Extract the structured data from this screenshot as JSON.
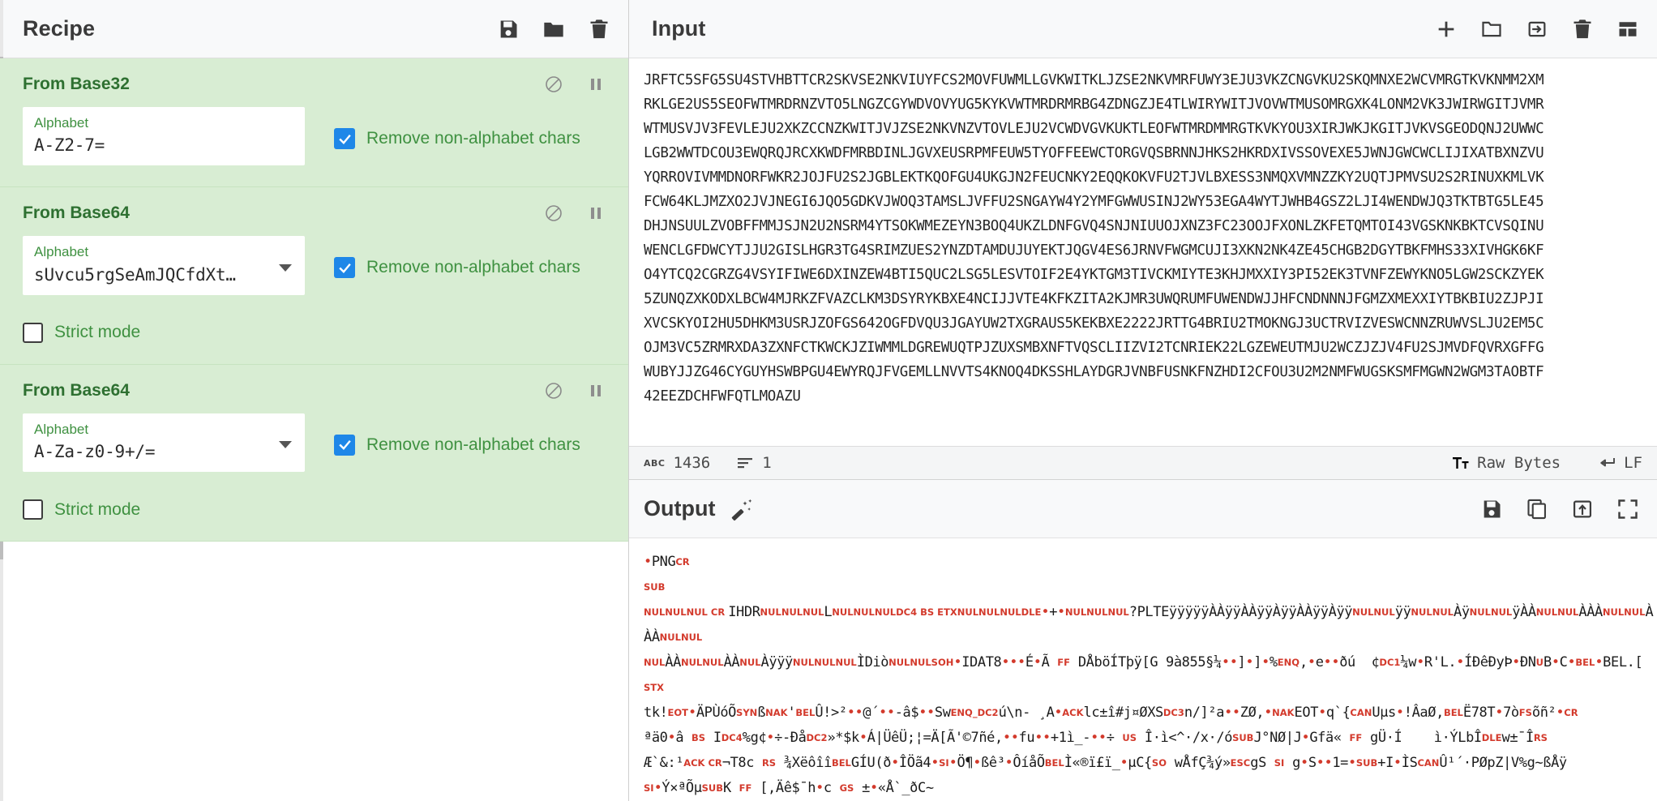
{
  "recipe": {
    "title": "Recipe",
    "header_icons": [
      {
        "name": "save-recipe-icon",
        "label": "Save recipe"
      },
      {
        "name": "load-recipe-icon",
        "label": "Load recipe"
      },
      {
        "name": "clear-recipe-icon",
        "label": "Clear recipe"
      }
    ],
    "operations": [
      {
        "title": "From Base32",
        "arg_label": "Alphabet",
        "arg_value": "A-Z2-7=",
        "has_dropdown": false,
        "checkbox_label": "Remove non-alphabet chars",
        "checkbox_checked": true,
        "has_strict": false,
        "strict_label": "",
        "strict_checked": false,
        "disable_icon": "disable-operation-icon",
        "pause_icon": "breakpoint-icon"
      },
      {
        "title": "From Base64",
        "arg_label": "Alphabet",
        "arg_value": "sUvcu5rgSeAmJQCfdXt…",
        "has_dropdown": true,
        "checkbox_label": "Remove non-alphabet chars",
        "checkbox_checked": true,
        "has_strict": true,
        "strict_label": "Strict mode",
        "strict_checked": false,
        "disable_icon": "disable-operation-icon",
        "pause_icon": "breakpoint-icon"
      },
      {
        "title": "From Base64",
        "arg_label": "Alphabet",
        "arg_value": "A-Za-z0-9+/=",
        "has_dropdown": true,
        "checkbox_label": "Remove non-alphabet chars",
        "checkbox_checked": true,
        "has_strict": true,
        "strict_label": "Strict mode",
        "strict_checked": false,
        "disable_icon": "disable-operation-icon",
        "pause_icon": "breakpoint-icon"
      }
    ]
  },
  "input": {
    "title": "Input",
    "header_icons": [
      {
        "name": "add-input-tab-icon",
        "label": "Add a new input tab"
      },
      {
        "name": "open-folder-icon",
        "label": "Open folder as input"
      },
      {
        "name": "open-file-icon",
        "label": "Open file as input"
      },
      {
        "name": "clear-input-icon",
        "label": "Clear input and output"
      },
      {
        "name": "reset-pane-layout-icon",
        "label": "Reset pane layout"
      }
    ],
    "text": "JRFTC5SFG5SU4STVHBTTCR2SKVSE2NKVIUYFCS2MOVFUWMLLGVKWITKLJZSE2NKVMRFUWY3EJU3VKZCNGVKU2SKQMNXE2WCVMRGTKVKNMM2XM\nRKLGE2US5SEOFWTMRDRNZVTO5LNGZCGYWDVOVYUG5KYKVWTMRDRMRBG4ZDNGZJE4TLWIRYWITJVOVWTMUSOMRGXK4LONM2VK3JWIRWGITJVMR\nWTMUSVJV3FEVLEJU2XKZCCNZKWITJVJZSE2NKVNZVTOVLEJU2VCWDVGVKUKTLEOFWTMRDMMRGTKVKYOU3XIRJWKJKGITJVKVSGEODQNJ2UWWC\nLGB2WWTDCOU3EWQRQJRCXKWDFMRBDINLJGVXEUSRPMFEUW5TYOFFEEWCTORGVQSBRNNJHKS2HKRDXIVSSOVEXE5JWNJGWCWCLIJIXATBXNZVU\nYQRROVIVMMDNORFWKR2JOJFU2S2JGBLEKTKQOFGU4UKGJN2FEUCNKY2EQQKOKVFU2TJVLBXESS3NMQXVMNZZKY2UQTJPMVSU2S2RINUXKMLVK\nFCW64KLJMZXO2JVJNEGI6JQO5GDKVJWOQ3TAMSLJVFFU2SNGAYW4Y2YMFGWWUSINJ2WY53EGA4WYTJWHB4GSZ2LJI4WENDWJQ3TKTBTG5LE45\nDHJNSUULZVOBFFMMJSJN2U2NSRM4YTSOKWMEZEYN3BOQ4UKZLDNFGVQ4SNJNIUUOJXNZ3FC23OOJFXONLZKFETQMTOI43VGSKNKBKTCVSQINU\nWENCLGFDWCYTJJU2GISLHGR3TG4SRIMZUES2YNZDTAMDUJUYEKTJQGV4ES6JRNVFWGMCUJI3XKN2NK4ZE45CHGB2DGYTBKFMHS33XIVHGK6KF\nO4YTCQ2CGRZG4VSYIFIWE6DXINZEW4BTI5QUC2LSG5LESVTOIF2E4YKTGM3TIVCKMIYTE3KHJMXXIY3PI52EK3TVNFZEWYKNO5LGW2SCKZYEK\n5ZUNQZXKODXLBCW4MJRKZFVAZCLKM3DSYRYKBXE4NCIJJVTE4KFKZITA2KJMR3UWQRUMFUWENDWJJHFCNDNNNJFGMZXMEXXIYTBKBIU2ZJPJI\nXVCSKYOI2HU5DHKM3USRJZOFGS642OGFDVQU3JGAYUW2TXGRAUS5KEKBXE2222JRTTG4BRIU2TMOKNGJ3UCTRVIZVESWCNNZRUWVSLJU2EM5C\nOJM3VC5ZRMRXDA3ZXNFCTKWCKJZIWMMLDGREWUQTPJZUXSMBXNFTVQSCLIIZVI2TCNRIEK22LGZEWEUTMJU2WCZJZJV4FU2SJMVDFQVRXGFFG\nWUBYJJZG46CYGUYHSWBPGU4EWYRQJFVGEMLLNVVTS4KNOQ4DKSSHLAYDGRJVNBFUSNKFNZHDI2CFOU3U2M2NMFWUGSKSMFMGWN2WGM3TAOBTF\n42EEZDCHFWFQTLMOAZU",
    "status": {
      "length_icon": "character-count-icon",
      "length": "1436",
      "lines_icon": "line-count-icon",
      "lines": "1",
      "font_icon": "font-size-icon",
      "encoding": "Raw Bytes",
      "line_ending_icon": "line-ending-icon",
      "line_ending": "LF"
    }
  },
  "output": {
    "title": "Output",
    "magic_icon": "magic-wand-icon",
    "header_icons": [
      {
        "name": "save-output-icon",
        "label": "Save output to file"
      },
      {
        "name": "copy-output-icon",
        "label": "Copy raw output to clipboard"
      },
      {
        "name": "replace-input-icon",
        "label": "Replace input with output"
      },
      {
        "name": "maximise-output-icon",
        "label": "Maximise output pane"
      }
    ],
    "lines": [
      [
        {
          "t": "dot",
          "v": "•"
        },
        {
          "t": "plain",
          "v": "PNG"
        },
        {
          "t": "ctrl",
          "v": "CR"
        }
      ],
      [
        {
          "t": "ctrl",
          "v": "SUB"
        }
      ],
      [
        {
          "t": "ctrl",
          "v": "NULNULNUL"
        },
        {
          "t": "ctrl",
          "v": " CR "
        },
        {
          "t": "plain",
          "v": "IHDR"
        },
        {
          "t": "ctrl",
          "v": "NULNULNUL"
        },
        {
          "t": "plain",
          "v": "L"
        },
        {
          "t": "ctrl",
          "v": "NULNULNUL"
        },
        {
          "t": "ctrl",
          "v": "DC4 BS ETX"
        },
        {
          "t": "ctrl",
          "v": "NULNULNUL"
        },
        {
          "t": "ctrl",
          "v": "DLE"
        },
        {
          "t": "dot",
          "v": "•"
        },
        {
          "t": "plain",
          "v": "+"
        },
        {
          "t": "dot",
          "v": "•"
        },
        {
          "t": "ctrl",
          "v": "NULNULNUL"
        },
        {
          "t": "plain",
          "v": "?PLTEÿÿÿÿÿÀÀÿÿÀÀÿÿÀÿÿÀÀÿÿÀÿÿ"
        },
        {
          "t": "ctrl",
          "v": "NULNUL"
        },
        {
          "t": "plain",
          "v": "ÿÿ"
        },
        {
          "t": "ctrl",
          "v": "NULNUL"
        },
        {
          "t": "plain",
          "v": "Àÿ"
        },
        {
          "t": "ctrl",
          "v": "NULNUL"
        },
        {
          "t": "plain",
          "v": "ÿÀÀ"
        },
        {
          "t": "ctrl",
          "v": "NULNUL"
        },
        {
          "t": "plain",
          "v": "ÀÀÀ"
        },
        {
          "t": "ctrl",
          "v": "NULNUL"
        },
        {
          "t": "plain",
          "v": "ÀÀÀ"
        },
        {
          "t": "ctrl",
          "v": "NULNUL"
        }
      ],
      [
        {
          "t": "ctrl",
          "v": "NUL"
        },
        {
          "t": "plain",
          "v": "ÀÀ"
        },
        {
          "t": "ctrl",
          "v": "NULNUL"
        },
        {
          "t": "plain",
          "v": "ÀÀ"
        },
        {
          "t": "ctrl",
          "v": "NUL"
        },
        {
          "t": "plain",
          "v": "Àÿÿÿ"
        },
        {
          "t": "ctrl",
          "v": "NULNULNUL"
        },
        {
          "t": "plain",
          "v": "ÌDiò"
        },
        {
          "t": "ctrl",
          "v": "NULNULSOH"
        },
        {
          "t": "dot",
          "v": "•"
        },
        {
          "t": "plain",
          "v": "IDAT8"
        },
        {
          "t": "dot",
          "v": "•••"
        },
        {
          "t": "plain",
          "v": "É"
        },
        {
          "t": "dot",
          "v": "•"
        },
        {
          "t": "plain",
          "v": "Ã "
        },
        {
          "t": "ctrl",
          "v": "FF"
        },
        {
          "t": "plain",
          "v": " DÅböÍTþÿ[G 9à855§¼"
        },
        {
          "t": "dot",
          "v": "••"
        },
        {
          "t": "plain",
          "v": "]"
        },
        {
          "t": "dot",
          "v": "•"
        },
        {
          "t": "plain",
          "v": "]"
        },
        {
          "t": "dot",
          "v": "•"
        },
        {
          "t": "plain",
          "v": "%"
        },
        {
          "t": "ctrl",
          "v": "ENQ"
        },
        {
          "t": "plain",
          "v": ","
        },
        {
          "t": "dot",
          "v": "•"
        },
        {
          "t": "plain",
          "v": "e"
        },
        {
          "t": "dot",
          "v": "••"
        },
        {
          "t": "plain",
          "v": "ðú  ¢"
        },
        {
          "t": "ctrl",
          "v": "DC1"
        },
        {
          "t": "plain",
          "v": "¼w"
        },
        {
          "t": "dot",
          "v": "•"
        },
        {
          "t": "plain",
          "v": "R'L."
        },
        {
          "t": "dot",
          "v": "•"
        },
        {
          "t": "plain",
          "v": "ÍÐêÐyÞ"
        },
        {
          "t": "dot",
          "v": "•"
        },
        {
          "t": "plain",
          "v": "ÐN"
        },
        {
          "t": "ctrl",
          "v": "U"
        },
        {
          "t": "plain",
          "v": "B"
        },
        {
          "t": "dot",
          "v": "•"
        },
        {
          "t": "plain",
          "v": "C"
        },
        {
          "t": "dot",
          "v": "•"
        },
        {
          "t": "ctrl",
          "v": "BEL"
        },
        {
          "t": "dot",
          "v": "•"
        },
        {
          "t": "plain",
          "v": "BEL."
        },
        {
          "t": "plain",
          "v": "[ "
        },
        {
          "t": "ctrl",
          "v": "STX"
        }
      ],
      [
        {
          "t": "plain",
          "v": "tk!"
        },
        {
          "t": "ctrl",
          "v": "EOT"
        },
        {
          "t": "dot",
          "v": "•"
        },
        {
          "t": "plain",
          "v": "ÄPÙóÕ"
        },
        {
          "t": "ctrl",
          "v": "SYN"
        },
        {
          "t": "plain",
          "v": "ß"
        },
        {
          "t": "ctrl",
          "v": "NAK"
        },
        {
          "t": "plain",
          "v": "'"
        },
        {
          "t": "ctrl",
          "v": "BEL"
        },
        {
          "t": "plain",
          "v": "Û!>²"
        },
        {
          "t": "dot",
          "v": "••"
        },
        {
          "t": "plain",
          "v": "@´"
        },
        {
          "t": "dot",
          "v": "••"
        },
        {
          "t": "plain",
          "v": "-â$"
        },
        {
          "t": "dot",
          "v": "••"
        },
        {
          "t": "plain",
          "v": "Sw"
        },
        {
          "t": "ctrl",
          "v": "ENQ_DC2"
        },
        {
          "t": "plain",
          "v": "ú\\n- ¸A"
        },
        {
          "t": "dot",
          "v": "•"
        },
        {
          "t": "ctrl",
          "v": "ACK"
        },
        {
          "t": "plain",
          "v": "lc±î#j¤ØXS"
        },
        {
          "t": "ctrl",
          "v": "DC3"
        },
        {
          "t": "plain",
          "v": "n/]²a"
        },
        {
          "t": "dot",
          "v": "••"
        },
        {
          "t": "plain",
          "v": "ZØ,"
        },
        {
          "t": "dot",
          "v": "•"
        },
        {
          "t": "ctrl",
          "v": "NAK"
        },
        {
          "t": "plain",
          "v": "EOT"
        },
        {
          "t": "dot",
          "v": "•"
        },
        {
          "t": "plain",
          "v": "q`{"
        },
        {
          "t": "ctrl",
          "v": "CAN"
        },
        {
          "t": "plain",
          "v": "Uµs"
        },
        {
          "t": "dot",
          "v": "•"
        },
        {
          "t": "plain",
          "v": "!ÂaØ,"
        },
        {
          "t": "ctrl",
          "v": "BEL"
        },
        {
          "t": "plain",
          "v": "Ë78T"
        },
        {
          "t": "dot",
          "v": "•"
        },
        {
          "t": "plain",
          "v": "7ò"
        },
        {
          "t": "ctrl",
          "v": "FS"
        },
        {
          "t": "plain",
          "v": "õñ²"
        },
        {
          "t": "dot",
          "v": "•"
        },
        {
          "t": "ctrl",
          "v": "CR"
        }
      ],
      [
        {
          "t": "plain",
          "v": "ªä0"
        },
        {
          "t": "dot",
          "v": "•"
        },
        {
          "t": "plain",
          "v": "â "
        },
        {
          "t": "ctrl",
          "v": "BS"
        },
        {
          "t": "plain",
          "v": " I"
        },
        {
          "t": "ctrl",
          "v": "DC4"
        },
        {
          "t": "plain",
          "v": "%g¢"
        },
        {
          "t": "dot",
          "v": "•"
        },
        {
          "t": "plain",
          "v": "÷-Ðå"
        },
        {
          "t": "ctrl",
          "v": "DC2"
        },
        {
          "t": "plain",
          "v": "»*$k"
        },
        {
          "t": "dot",
          "v": "•"
        },
        {
          "t": "plain",
          "v": "Á|ÜêÜ;¦=Ä[Ã'©7ñé,"
        },
        {
          "t": "dot",
          "v": "••"
        },
        {
          "t": "plain",
          "v": "fu"
        },
        {
          "t": "dot",
          "v": "••"
        },
        {
          "t": "plain",
          "v": "+1ì_-"
        },
        {
          "t": "dot",
          "v": "••"
        },
        {
          "t": "plain",
          "v": "÷ "
        },
        {
          "t": "ctrl",
          "v": "US"
        },
        {
          "t": "plain",
          "v": " Î·ì<^·/x·/ó"
        },
        {
          "t": "ctrl",
          "v": "SUB"
        },
        {
          "t": "plain",
          "v": "J°NØ|J"
        },
        {
          "t": "dot",
          "v": "•"
        },
        {
          "t": "plain",
          "v": "Gfä« "
        },
        {
          "t": "ctrl",
          "v": "FF"
        },
        {
          "t": "plain",
          "v": " gÜ·Í    ì·ÝLbÎ"
        },
        {
          "t": "ctrl",
          "v": "DLE"
        },
        {
          "t": "plain",
          "v": "w±¯Î"
        },
        {
          "t": "ctrl",
          "v": "RS"
        }
      ],
      [
        {
          "t": "plain",
          "v": "Æ`&:¹"
        },
        {
          "t": "ctrl",
          "v": "ACK CR"
        },
        {
          "t": "plain",
          "v": "¬T8c "
        },
        {
          "t": "ctrl",
          "v": "RS"
        },
        {
          "t": "plain",
          "v": " ¾Xëôîî"
        },
        {
          "t": "ctrl",
          "v": "BEL"
        },
        {
          "t": "plain",
          "v": "GÍU(ð"
        },
        {
          "t": "dot",
          "v": "•"
        },
        {
          "t": "plain",
          "v": "ÎÖã4"
        },
        {
          "t": "dot",
          "v": "•"
        },
        {
          "t": "ctrl",
          "v": "SI"
        },
        {
          "t": "dot",
          "v": "•"
        },
        {
          "t": "plain",
          "v": "Ö¶"
        },
        {
          "t": "dot",
          "v": "•"
        },
        {
          "t": "plain",
          "v": "ßê³"
        },
        {
          "t": "dot",
          "v": "•"
        },
        {
          "t": "plain",
          "v": "ÔíåÕ"
        },
        {
          "t": "ctrl",
          "v": "BEL"
        },
        {
          "t": "plain",
          "v": "Ì«®ï£ï_"
        },
        {
          "t": "dot",
          "v": "•"
        },
        {
          "t": "plain",
          "v": "µC{"
        },
        {
          "t": "ctrl",
          "v": "SO"
        },
        {
          "t": "plain",
          "v": " wÅfÇ¾ý»"
        },
        {
          "t": "ctrl",
          "v": "ESC"
        },
        {
          "t": "plain",
          "v": "gS "
        },
        {
          "t": "ctrl",
          "v": "SI"
        },
        {
          "t": "plain",
          "v": " g"
        },
        {
          "t": "dot",
          "v": "•"
        },
        {
          "t": "plain",
          "v": "S"
        },
        {
          "t": "dot",
          "v": "••"
        },
        {
          "t": "plain",
          "v": "1="
        },
        {
          "t": "dot",
          "v": "•"
        },
        {
          "t": "ctrl",
          "v": "SUB"
        },
        {
          "t": "plain",
          "v": "+I"
        },
        {
          "t": "dot",
          "v": "•"
        },
        {
          "t": "plain",
          "v": "ÌS"
        },
        {
          "t": "ctrl",
          "v": "CAN"
        },
        {
          "t": "plain",
          "v": "Û¹´·PØpZ|V%g~ßÅÿ"
        }
      ],
      [
        {
          "t": "ctrl",
          "v": "SI"
        },
        {
          "t": "dot",
          "v": "•"
        },
        {
          "t": "plain",
          "v": "Ý×ªÕµ"
        },
        {
          "t": "ctrl",
          "v": "SUB"
        },
        {
          "t": "plain",
          "v": "K "
        },
        {
          "t": "ctrl",
          "v": "FF"
        },
        {
          "t": "plain",
          "v": " [,Äê$¯h"
        },
        {
          "t": "dot",
          "v": "•"
        },
        {
          "t": "plain",
          "v": "c "
        },
        {
          "t": "ctrl",
          "v": "GS"
        },
        {
          "t": "plain",
          "v": " ±"
        },
        {
          "t": "dot",
          "v": "•"
        },
        {
          "t": "plain",
          "v": "«Å`_ðC~"
        }
      ]
    ]
  }
}
